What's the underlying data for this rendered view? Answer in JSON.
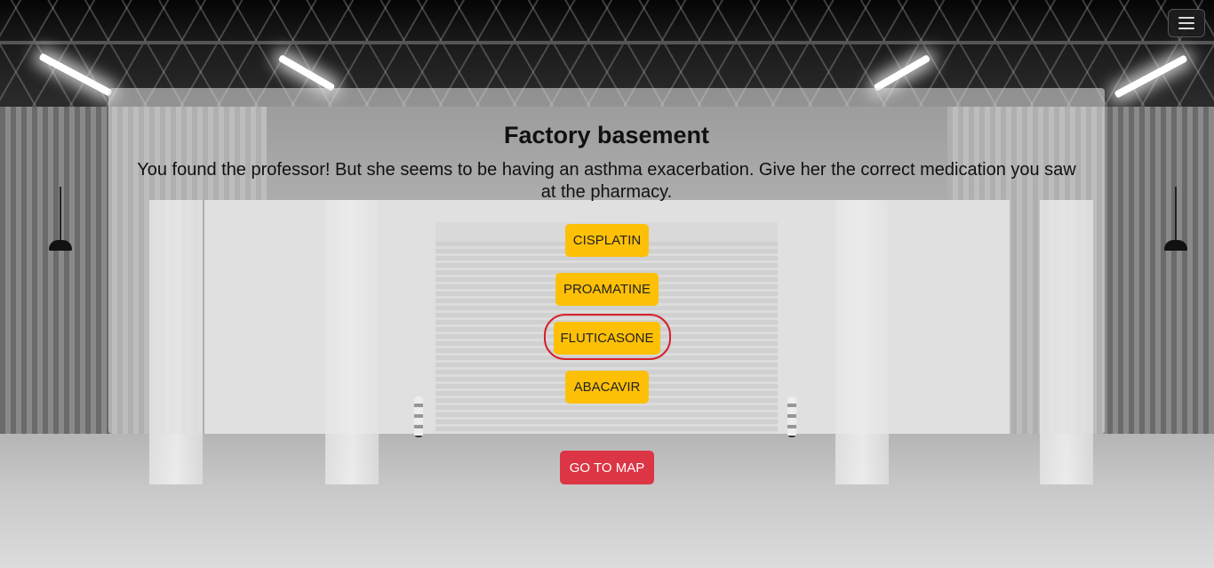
{
  "scene": {
    "title": "Factory basement",
    "message": "You found the professor! But she seems to be having an asthma exacerbation. Give her the correct medication you saw at the pharmacy."
  },
  "options": [
    {
      "label": "CISPLATIN"
    },
    {
      "label": "PROAMATINE"
    },
    {
      "label": "FLUTICASONE",
      "highlighted": true
    },
    {
      "label": "ABACAVIR"
    }
  ],
  "go_to_map_label": "GO TO MAP",
  "colors": {
    "option_bg": "#fdc007",
    "go_button_bg": "#dc3545",
    "highlight_ring": "#d6202b"
  },
  "icons": {
    "menu": "hamburger-menu-icon"
  }
}
